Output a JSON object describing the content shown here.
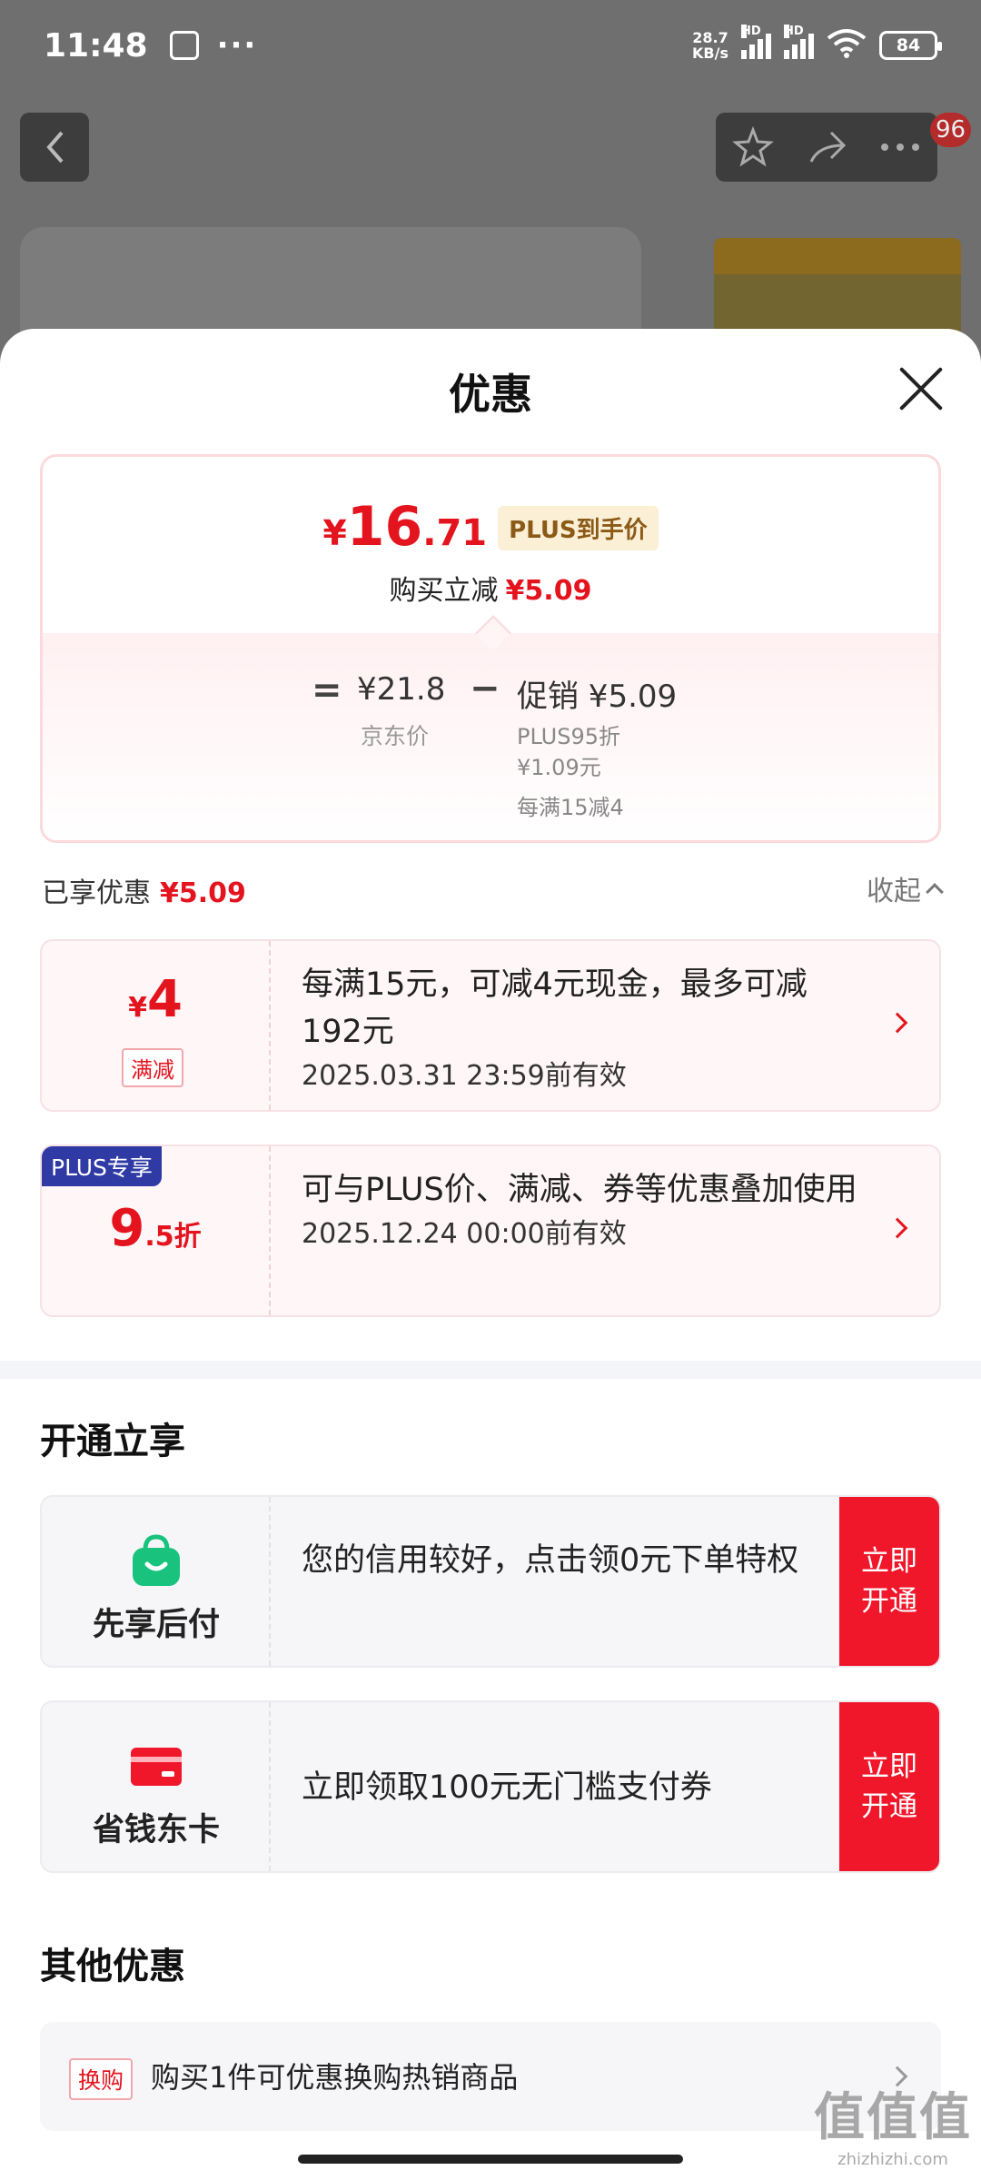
{
  "status_bar": {
    "time": "11:48",
    "dots": "···",
    "net_speed_value": "28.7",
    "net_speed_unit": "KB/s",
    "signal_label": "HD",
    "battery": "84"
  },
  "background_page": {
    "back_icon": "chevron-left-icon",
    "action_icons": [
      "star-icon",
      "share-icon",
      "more-icon"
    ],
    "cart_badge": "96"
  },
  "sheet": {
    "title": "优惠",
    "close_icon": "close-icon"
  },
  "summary": {
    "price_currency": "¥",
    "price_integer": "16",
    "price_decimal": ".71",
    "price_tag": "PLUS到手价",
    "save_label": "购买立减",
    "save_amount": "¥5.09",
    "eq": "=",
    "minus": "−",
    "jd_price": "¥21.8",
    "jd_price_label": "京东价",
    "promo": "促销 ¥5.09",
    "promo_line1": "PLUS95折",
    "promo_line2": "¥1.09元",
    "promo_line3": "每满15减4"
  },
  "enjoyed": {
    "label": "已享优惠",
    "amount": "¥5.09",
    "collapse_label": "收起"
  },
  "offers": [
    {
      "amount_prefix": "¥",
      "amount": "4",
      "tag": "满减",
      "text": "每满15元，可减4元现金，最多可减192元",
      "date": "2025.03.31 23:59前有效"
    },
    {
      "corner": "PLUS专享",
      "amount": "9",
      "amount_suffix": ".5折",
      "text": "可与PLUS价、满减、券等优惠叠加使用",
      "date": "2025.12.24 00:00前有效"
    }
  ],
  "open_section": {
    "title": "开通立享",
    "items": [
      {
        "icon": "shopping-bag-icon",
        "label": "先享后付",
        "text": "您的信用较好，点击领0元下单特权",
        "button": "立即开通",
        "color": "#19c37d"
      },
      {
        "icon": "card-icon",
        "label": "省钱东卡",
        "text": "立即领取100元无门槛支付券",
        "button": "立即开通",
        "color": "#f0172b"
      }
    ]
  },
  "other_section": {
    "title": "其他优惠",
    "items": [
      {
        "tag": "换购",
        "text": "购买1件可优惠换购热销商品"
      }
    ]
  },
  "watermark": {
    "logo": "值值值",
    "url": "zhizhizhi.com"
  },
  "colors": {
    "accent_red": "#e4141e",
    "button_red": "#f0172b",
    "plus_blue": "#2f3aa5",
    "plus_gold_text": "#8b5a17"
  }
}
